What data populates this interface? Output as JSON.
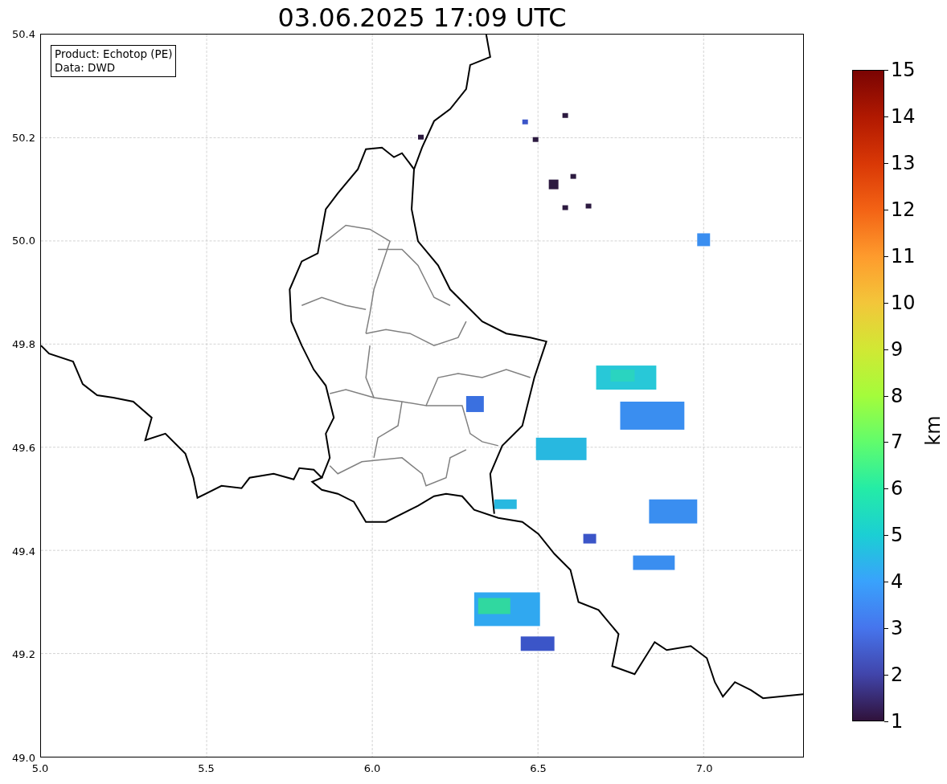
{
  "title": "03.06.2025 17:09 UTC",
  "info_box": [
    "Product: Echotop (PE)",
    "Data: DWD"
  ],
  "map": {
    "x_ticks": [
      "5.0",
      "5.5",
      "6.0",
      "6.5",
      "7.0"
    ],
    "y_ticks": [
      "50.4",
      "50.2",
      "50.0",
      "49.8",
      "49.6",
      "49.4",
      "49.2",
      "49.0"
    ]
  },
  "colorbar": {
    "label": "km",
    "ticks": [
      "15",
      "14",
      "13",
      "12",
      "11",
      "10",
      "9",
      "8",
      "7",
      "6",
      "5",
      "4",
      "3",
      "2",
      "1"
    ]
  }
}
